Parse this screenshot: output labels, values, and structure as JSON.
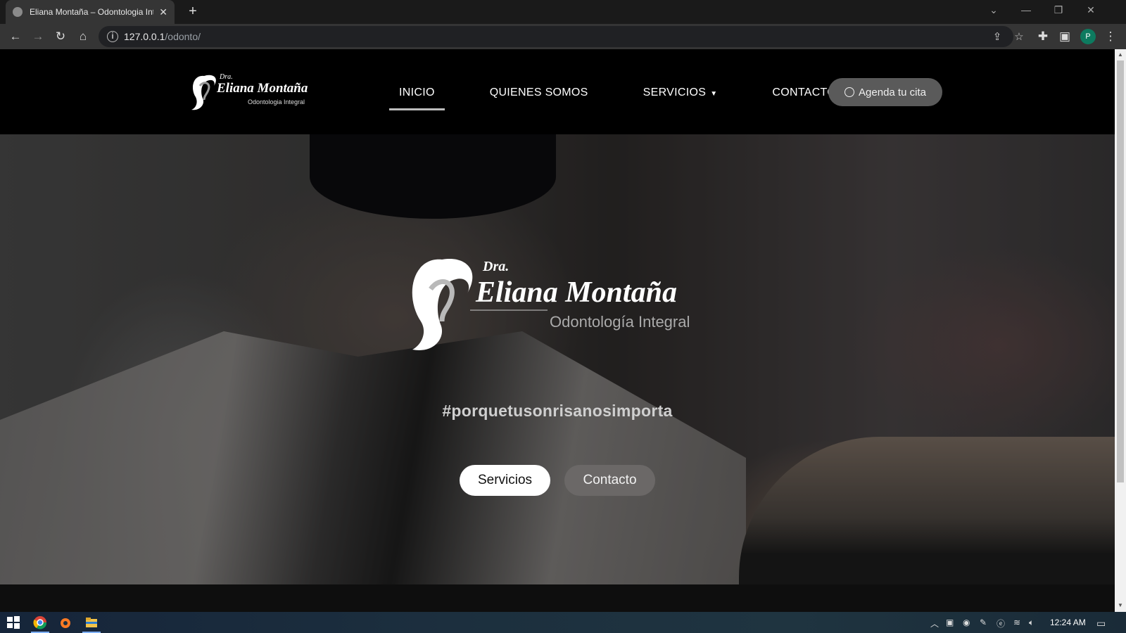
{
  "browser": {
    "tab_title": "Eliana Montaña – Odontologia Integral",
    "tab_close": "✕",
    "new_tab": "+",
    "url_host": "127.0.0.1",
    "url_path": "/odonto/",
    "profile_initial": "P"
  },
  "site": {
    "logo": {
      "prefix": "Dra.",
      "name": "Eliana Montaña",
      "subtitle": "Odontologia Integral"
    },
    "nav": {
      "items": [
        {
          "label": "INICIO",
          "active": true
        },
        {
          "label": "QUIENES SOMOS",
          "active": false
        },
        {
          "label": "SERVICIOS",
          "active": false,
          "has_dropdown": true
        },
        {
          "label": "CONTACTO",
          "active": false
        }
      ],
      "cta_label": "Agenda tu cita"
    },
    "hero": {
      "logo_prefix": "Dra.",
      "logo_name": "Eliana Montaña",
      "logo_subtitle": "Odontología Integral",
      "hashtag": "#porquetusonrisanosimporta",
      "buttons": [
        {
          "label": "Servicios"
        },
        {
          "label": "Contacto"
        }
      ]
    }
  },
  "taskbar": {
    "clock": "12:24 AM"
  },
  "colors": {
    "header_bg": "#000000",
    "cta_bg": "#5a5a5a",
    "primary_button_bg": "#ffffff",
    "secondary_button_bg": "#6b6867"
  }
}
